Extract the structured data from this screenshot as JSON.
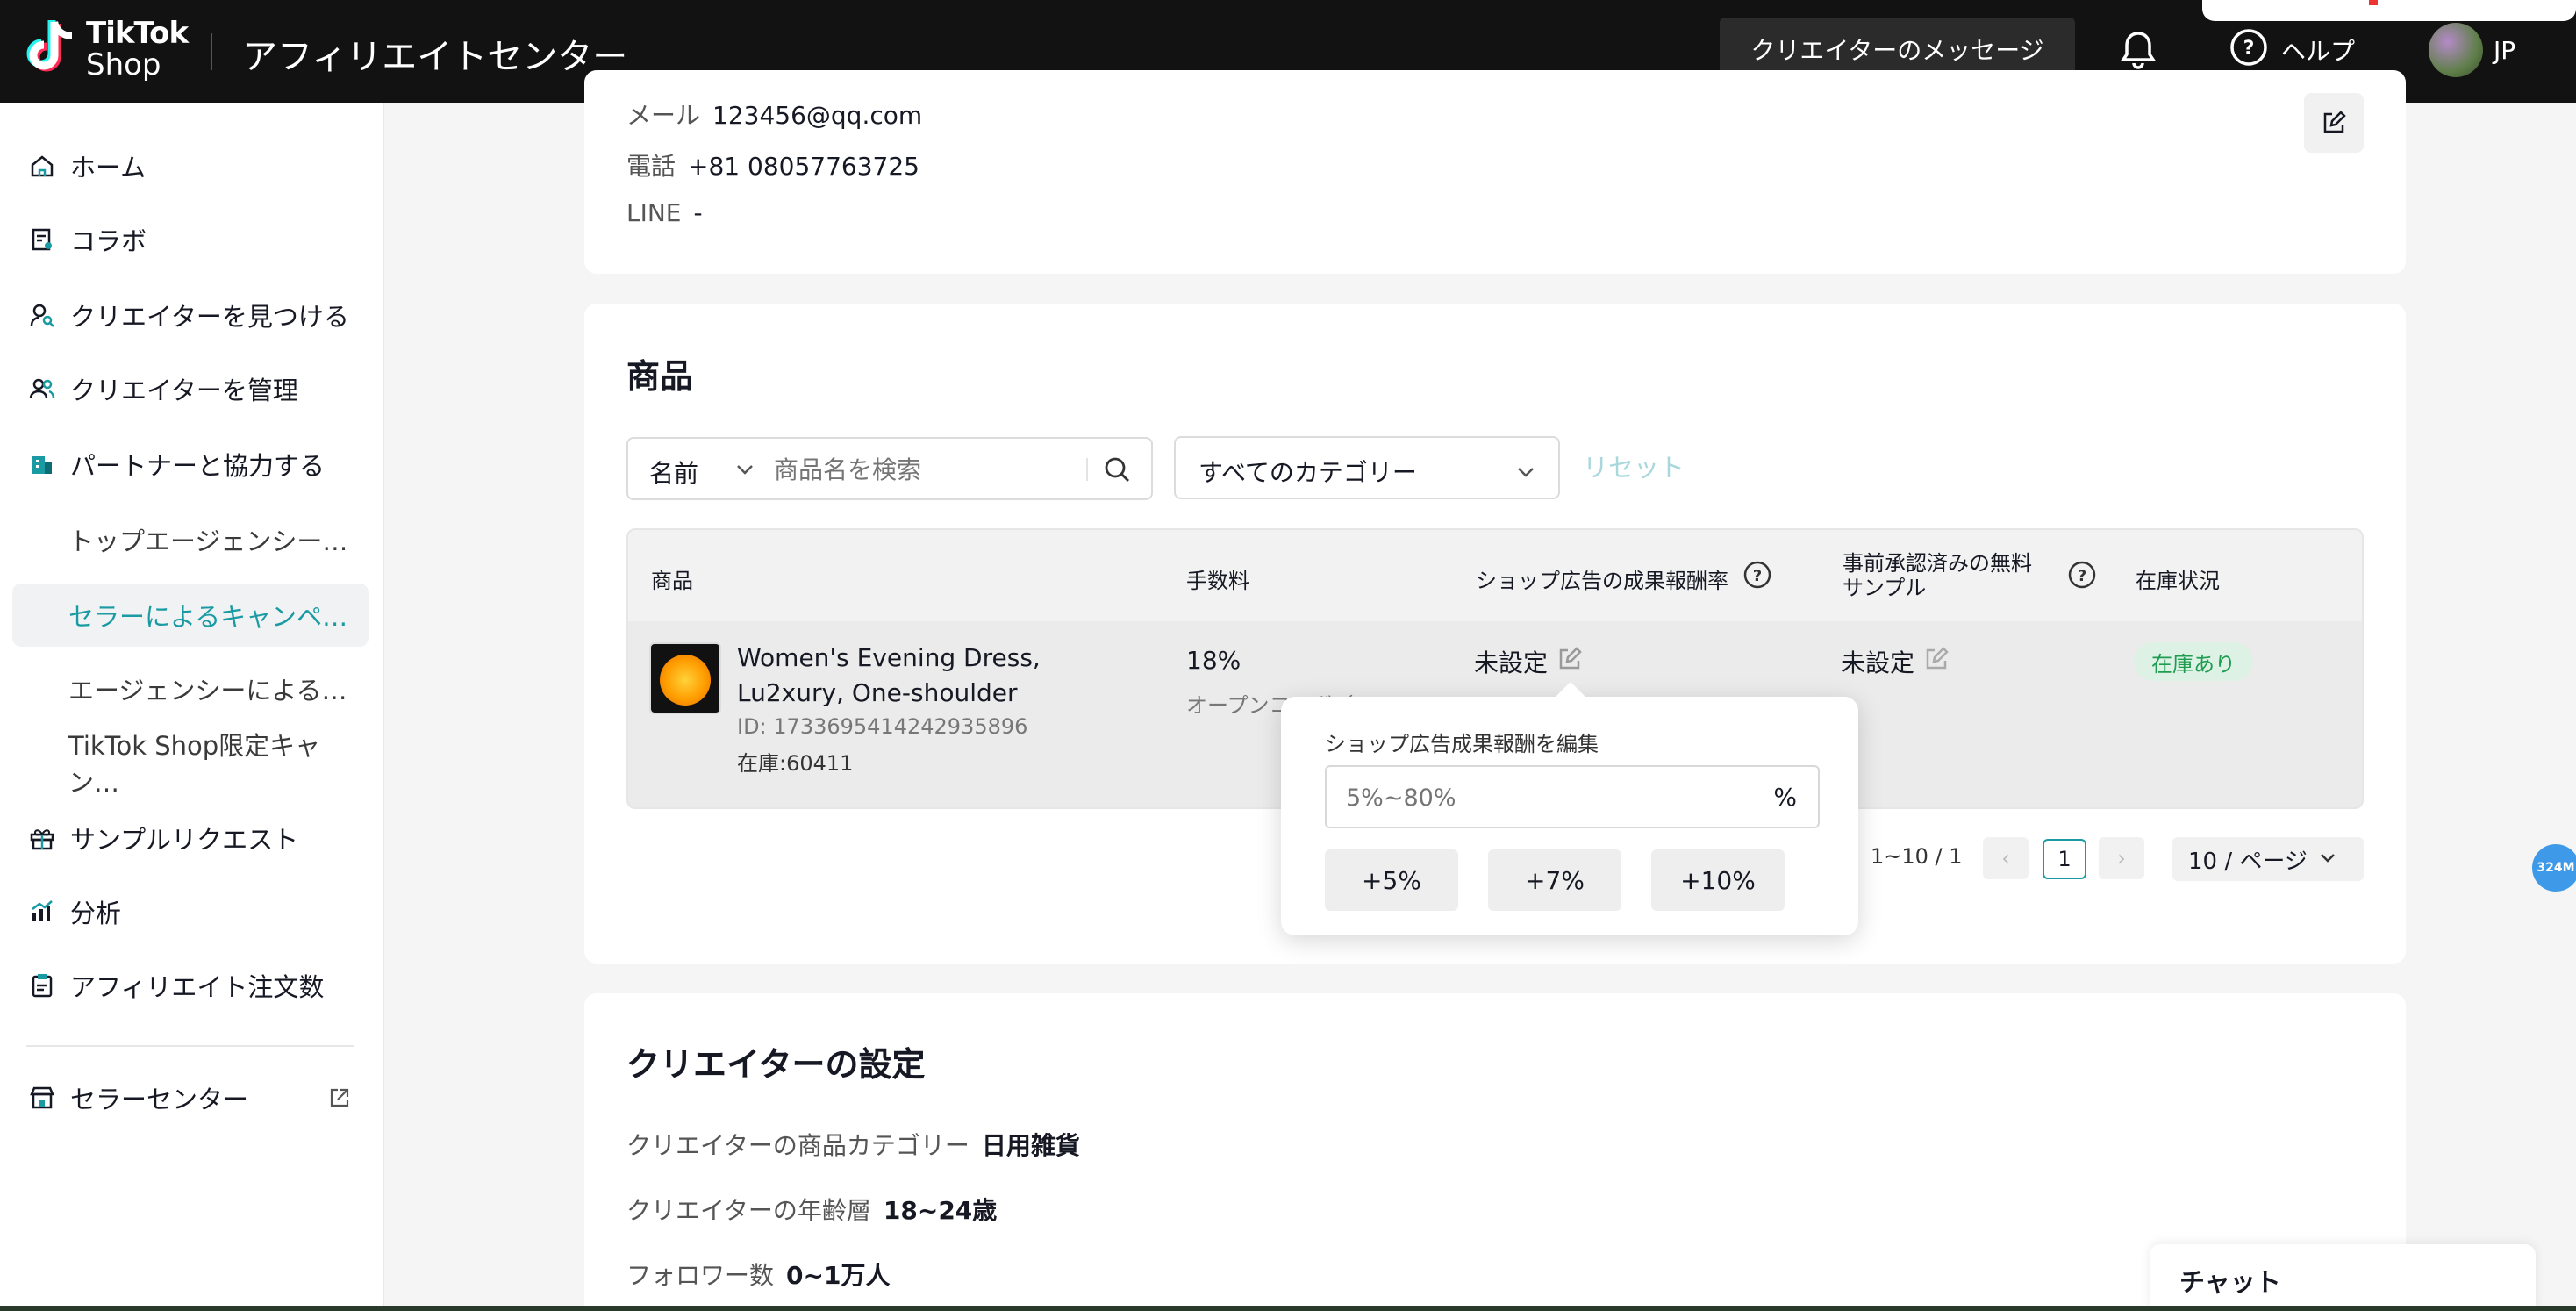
{
  "header": {
    "logo_line1": "TikTok",
    "logo_line2": "Shop",
    "app_title": "アフィリエイトセンター",
    "messages_button": "クリエイターのメッセージ",
    "help_label": "ヘルプ",
    "region": "JP"
  },
  "sidebar": {
    "items": [
      {
        "label": "ホーム",
        "icon": "home-icon"
      },
      {
        "label": "コラボ",
        "icon": "collab-icon"
      },
      {
        "label": "クリエイターを見つける",
        "icon": "find-creator-icon"
      },
      {
        "label": "クリエイターを管理",
        "icon": "manage-creator-icon"
      },
      {
        "label": "パートナーと協力する",
        "icon": "partner-icon"
      },
      {
        "label": "トップエージェンシー…"
      },
      {
        "label": "セラーによるキャンペ…"
      },
      {
        "label": "エージェンシーによる…"
      },
      {
        "label": "TikTok Shop限定キャン…"
      },
      {
        "label": "サンプルリクエスト",
        "icon": "gift-icon"
      },
      {
        "label": "分析",
        "icon": "analytics-icon"
      },
      {
        "label": "アフィリエイト注文数",
        "icon": "clipboard-icon"
      },
      {
        "label": "セラーセンター",
        "icon": "store-icon"
      }
    ],
    "active_index": 6
  },
  "contact": {
    "email_label": "メール",
    "email_value": "123456@qq.com",
    "phone_label": "電話",
    "phone_value": "+81 08057763725",
    "line_label": "LINE",
    "line_value": "-"
  },
  "products": {
    "title": "商品",
    "filter_select": "名前",
    "search_placeholder": "商品名を検索",
    "category_select": "すべてのカテゴリー",
    "reset_label": "リセット",
    "columns": [
      "商品",
      "手数料",
      "ショップ広告の成果報酬率",
      "事前承認済みの無料",
      "サンプル",
      "在庫状況"
    ],
    "row": {
      "name": "Women's Evening Dress, Lu2xury, One-shoulder",
      "id": "ID: 1733695414242935896",
      "stock": "在庫:60411",
      "commission": "18%",
      "commission_sub": "オープンコラボ（…",
      "ad_rate": "未設定",
      "free_sample": "未設定",
      "stock_status": "在庫あり"
    },
    "pagination": {
      "summary": "1~10 / 1",
      "current_page": "1",
      "page_size": "10 / ページ"
    }
  },
  "popover": {
    "title": "ショップ広告成果報酬を編集",
    "placeholder": "5%~80%",
    "unit": "%",
    "buttons": [
      "+5%",
      "+7%",
      "+10%"
    ]
  },
  "creator_settings": {
    "title": "クリエイターの設定",
    "category_label": "クリエイターの商品カテゴリー",
    "category_value": "日用雑貨",
    "age_label": "クリエイターの年齢層",
    "age_value": "18~24歳",
    "followers_label": "フォロワー数",
    "followers_value": "0~1万人"
  },
  "float_badge": "324M",
  "chat_label": "チャット",
  "colors": {
    "accent": "#1a9aa3",
    "topbar": "#121212",
    "in_stock_bg": "#ddf2e4",
    "in_stock_text": "#1e9c50"
  }
}
